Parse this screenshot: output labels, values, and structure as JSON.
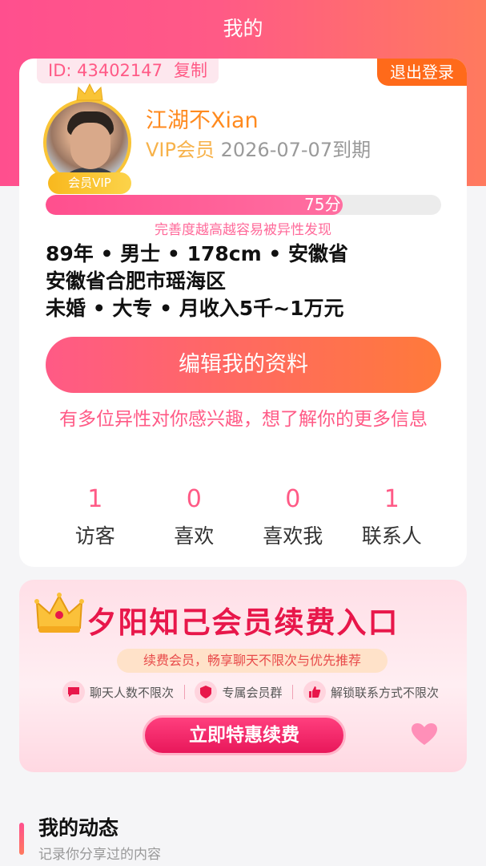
{
  "header": {
    "title": "我的"
  },
  "profile": {
    "id_label": "ID: 43402147",
    "copy_label": "复制",
    "logout_label": "退出登录",
    "vip_badge": "会员VIP",
    "username": "江湖不Xian",
    "vip_label": "VIP会员",
    "vip_expiry": "2026-07-07到期",
    "completeness_score_label": "75分",
    "completeness_percent": 75,
    "completeness_tip": "完善度越高越容易被异性发现",
    "info_line1": "89年 • 男士 • 178cm • 安徽省",
    "info_line2": "安徽省合肥市瑶海区",
    "info_line3": "未婚 • 大专 • 月收入5千~1万元",
    "edit_label": "编辑我的资料",
    "interest_text": "有多位异性对你感兴趣，想了解你的更多信息",
    "stats": [
      {
        "value": "1",
        "label": "访客"
      },
      {
        "value": "0",
        "label": "喜欢"
      },
      {
        "value": "0",
        "label": "喜欢我"
      },
      {
        "value": "1",
        "label": "联系人"
      }
    ]
  },
  "banner": {
    "title": "夕阳知己会员续费入口",
    "subtitle": "续费会员，畅享聊天不限次与优先推荐",
    "features": [
      {
        "icon": "chat-icon",
        "label": "聊天人数不限次"
      },
      {
        "icon": "vip-group-icon",
        "label": "专属会员群"
      },
      {
        "icon": "thumbs-up-icon",
        "label": "解锁联系方式不限次"
      }
    ],
    "button_label": "立即特惠续费"
  },
  "section": {
    "title": "我的动态",
    "subtitle": "记录你分享过的内容"
  },
  "colors": {
    "accent_pink": "#ff5a86",
    "accent_orange": "#ff7a3a",
    "vip_gold": "#f8b81e"
  }
}
